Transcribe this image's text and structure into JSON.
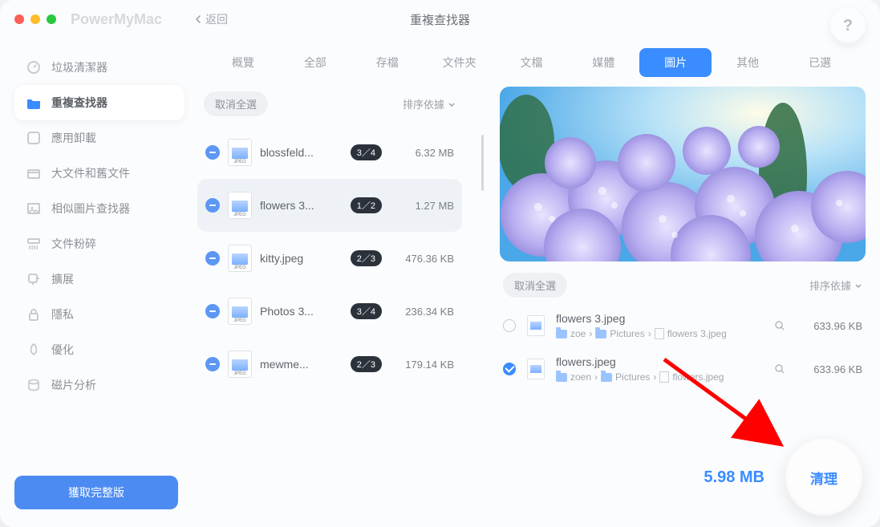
{
  "app_title": "PowerMyMac",
  "back_label": "返回",
  "page_title": "重複查找器",
  "help": "?",
  "sidebar": {
    "items": [
      {
        "label": "垃圾清潔器"
      },
      {
        "label": "重複查找器"
      },
      {
        "label": "應用卸載"
      },
      {
        "label": "大文件和舊文件"
      },
      {
        "label": "相似圖片查找器"
      },
      {
        "label": "文件粉碎"
      },
      {
        "label": "擴展"
      },
      {
        "label": "隱私"
      },
      {
        "label": "優化"
      },
      {
        "label": "磁片分析"
      }
    ],
    "full_version": "獲取完整版"
  },
  "tabs": [
    "概覽",
    "全部",
    "存檔",
    "文件夾",
    "文檔",
    "媒體",
    "圖片",
    "其他",
    "已選"
  ],
  "tabs_active": 6,
  "list": {
    "deselect_all": "取消全選",
    "sort": "排序依據",
    "rows": [
      {
        "name": "blossfeld...",
        "count": "3／4",
        "size": "6.32 MB"
      },
      {
        "name": "flowers 3...",
        "count": "1／2",
        "size": "1.27 MB"
      },
      {
        "name": "kitty.jpeg",
        "count": "2／3",
        "size": "476.36 KB"
      },
      {
        "name": "Photos 3...",
        "count": "3／4",
        "size": "236.34 KB"
      },
      {
        "name": "mewme...",
        "count": "2／3",
        "size": "179.14 KB"
      }
    ],
    "selected_index": 1
  },
  "dup": {
    "deselect_all": "取消全選",
    "sort": "排序依據",
    "rows": [
      {
        "checked": false,
        "name": "flowers 3.jpeg",
        "path": [
          "zoe",
          "Pictures",
          "flowers 3.jpeg"
        ],
        "size": "633.96 KB"
      },
      {
        "checked": true,
        "name": "flowers.jpeg",
        "path": [
          "zoen",
          "Pictures",
          "flowers.jpeg"
        ],
        "size": "633.96 KB"
      }
    ]
  },
  "total_size": "5.98 MB",
  "clean_label": "清理",
  "thumb_label": "JPEG",
  "chevron": "›"
}
